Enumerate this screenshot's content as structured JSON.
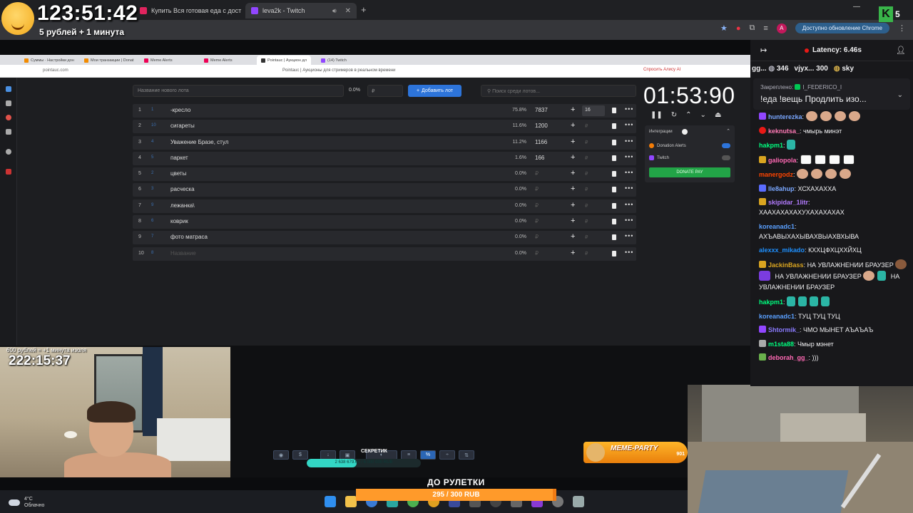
{
  "overlay": {
    "timer": "123:51:42",
    "rate": "5 рублей + 1 минута",
    "cam_rate": "600 рублей = +1 минута изоля",
    "cam_timer": "222:15:37"
  },
  "chrome": {
    "tabs": [
      {
        "label": "Купить Вся готовая еда с дост",
        "active": false,
        "close": "✕"
      },
      {
        "label": "leva2k - Twitch",
        "active": true,
        "close": "✕"
      }
    ],
    "new_tab": "+",
    "update_label": "Доступно обновление Chrome",
    "avatar_letter": "A",
    "kick_count": "5"
  },
  "inner_browser": {
    "tabs": [
      "Суммы · Настройки дон",
      "Мои транзакции | Donat",
      "Meme Alerts",
      "Meme Alerts",
      "Pointauc | Аукцион дл",
      "(14) Twitch"
    ],
    "url": "pointauc.com",
    "title": "Pointauc | Аукционы для стримеров в реальном времени",
    "alice": "Спросить Алису AI"
  },
  "auction": {
    "new_lot_placeholder": "Название нового лота",
    "percent_default": "0.0%",
    "rub_placeholder": "₽",
    "add_button": "Добавить лот",
    "search_placeholder": "Поиск среди лотов...",
    "timer": "01:53:90",
    "lots": [
      {
        "num": "1",
        "id": "1",
        "name": "-кресло",
        "pct": "75.8%",
        "amount": "7837",
        "input": "16"
      },
      {
        "num": "2",
        "id": "10",
        "name": "сигареты",
        "pct": "11.6%",
        "amount": "1200",
        "input": "₽"
      },
      {
        "num": "3",
        "id": "4",
        "name": "Уважение Бразе, стул",
        "pct": "11.2%",
        "amount": "1166",
        "input": "₽"
      },
      {
        "num": "4",
        "id": "5",
        "name": "паркет",
        "pct": "1.6%",
        "amount": "166",
        "input": "₽"
      },
      {
        "num": "5",
        "id": "2",
        "name": "цветы",
        "pct": "0.0%",
        "amount": "₽",
        "input": "₽"
      },
      {
        "num": "6",
        "id": "3",
        "name": "расческа",
        "pct": "0.0%",
        "amount": "₽",
        "input": "₽"
      },
      {
        "num": "7",
        "id": "9",
        "name": "лежанка\\",
        "pct": "0.0%",
        "amount": "₽",
        "input": "₽"
      },
      {
        "num": "8",
        "id": "6",
        "name": "коврик",
        "pct": "0.0%",
        "amount": "₽",
        "input": "₽"
      },
      {
        "num": "9",
        "id": "7",
        "name": "фото матраса",
        "pct": "0.0%",
        "amount": "₽",
        "input": "₽"
      },
      {
        "num": "10",
        "id": "8",
        "name": "Название",
        "pct": "0.0%",
        "amount": "₽",
        "input": "₽"
      }
    ],
    "integrations": {
      "title": "Интеграции",
      "donation_alerts": "Donation Alerts",
      "twitch": "Twitch",
      "donate_pay": "DONATE PAY"
    }
  },
  "stream_overlay": {
    "sekretik": "СЕКРЕТИК",
    "progress_text": "2 638 679.64 / 6 000 000 RUB",
    "progress_fraction": 0.44,
    "meme_party": "MEME-PARTY",
    "meme_num": "901",
    "do_ruletki": "ДО РУЛЕТКИ",
    "ruletka_progress": "295 / 300 RUB",
    "ruletka_fraction": 0.983
  },
  "taskbar": {
    "temp": "4°C",
    "weather": "Облачно"
  },
  "chat": {
    "latency": "Latency: 6.46s",
    "leaders": [
      {
        "name": "gg...",
        "value": "346"
      },
      {
        "name": "vjyx...",
        "value": "300"
      },
      {
        "name": "sky",
        "value": ""
      }
    ],
    "pinned_label": "Закреплено: ",
    "pinned_user": "I_FEDERICO_I",
    "pinned_text": "!еда !вещь Продлить изо...",
    "messages": [
      {
        "user": "hunterezka",
        "color": "#7aa7ff",
        "text": ""
      },
      {
        "user": "keknutsa_",
        "color": "#ff7ab6",
        "text": "чмырь минэт"
      },
      {
        "user": "hakpm1",
        "color": "#00ff7f",
        "text": ""
      },
      {
        "user": "galiopola",
        "color": "#ff69b4",
        "text": ""
      },
      {
        "user": "manergodz",
        "color": "#ff4500",
        "text": ""
      },
      {
        "user": "lle8ahup",
        "color": "#7aa7ff",
        "text": "ХСХАХАХХА"
      },
      {
        "user": "skipidar_1litr",
        "color": "#b37bff",
        "text": "ХААХАХАХАХУХАХАХАХАХ"
      },
      {
        "user": "koreanadc1",
        "color": "#5aa0ff",
        "text": "АХЪАВЫХАХЫВАХВЫАХВХЫВА"
      },
      {
        "user": "alexxx_mikado",
        "color": "#1e90ff",
        "text": "КХХЦФХЦХХЙХЦ"
      },
      {
        "user": "JackinBass",
        "color": "#daa520",
        "text": "НА УВЛАЖНЕНИИ БРАУЗЕР"
      },
      {
        "user": "hakpm1",
        "color": "#00ff7f",
        "text": ""
      },
      {
        "user": "koreanadc1",
        "color": "#5aa0ff",
        "text": "ТУЦ ТУЦ ТУЦ"
      },
      {
        "user": "Shtormik_",
        "color": "#8a7bff",
        "text": "ЧМО МЫНЕТ АЪАЪАЪ"
      },
      {
        "user": "m1sta88",
        "color": "#00ff7f",
        "text": "Чмыр мэнет"
      },
      {
        "user": "deborah_gg_",
        "color": "#ff69b4",
        "text": ")))"
      }
    ],
    "jackin_extra_1": "НА",
    "jackin_extra_2": "УВЛАЖНЕНИИ БРАУЗЕР",
    "jackin_extra_3": "НА УВЛАЖНЕНИИ БРАУЗЕР"
  }
}
